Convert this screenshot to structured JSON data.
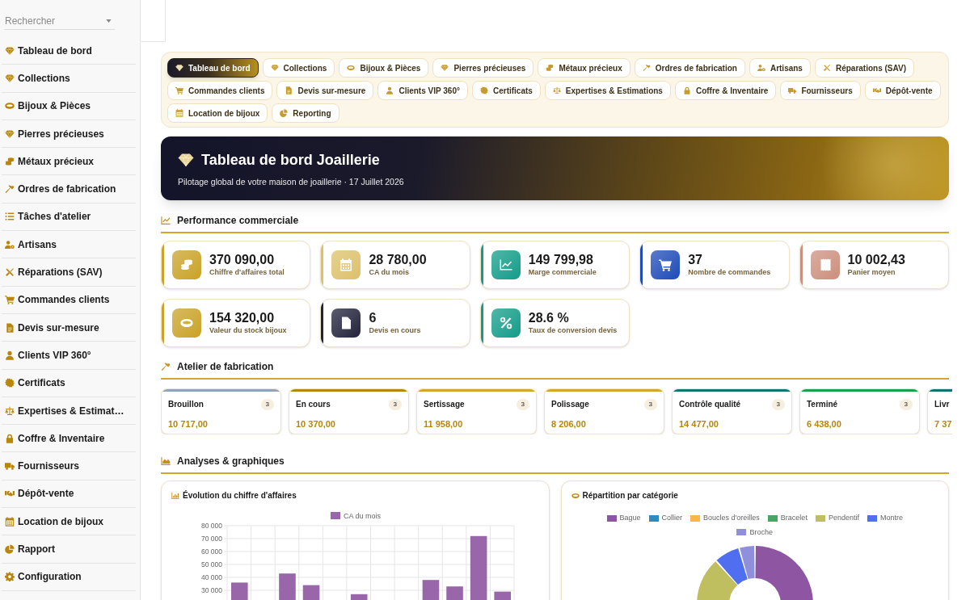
{
  "sidebar": {
    "search": {
      "placeholder": "Rechercher"
    },
    "items": [
      {
        "label": "Tableau de bord"
      },
      {
        "label": "Collections"
      },
      {
        "label": "Bijoux & Pièces"
      },
      {
        "label": "Pierres précieuses"
      },
      {
        "label": "Métaux précieux"
      },
      {
        "label": "Ordres de fabrication"
      },
      {
        "label": "Tâches d'atelier"
      },
      {
        "label": "Artisans"
      },
      {
        "label": "Réparations (SAV)"
      },
      {
        "label": "Commandes clients"
      },
      {
        "label": "Devis sur-mesure"
      },
      {
        "label": "Clients VIP 360°"
      },
      {
        "label": "Certificats"
      },
      {
        "label": "Expertises & Estimat…"
      },
      {
        "label": "Coffre & Inventaire"
      },
      {
        "label": "Fournisseurs"
      },
      {
        "label": "Dépôt-vente"
      },
      {
        "label": "Location de bijoux"
      },
      {
        "label": "Rapport"
      },
      {
        "label": "Configuration"
      }
    ]
  },
  "tabs": [
    {
      "label": "Tableau de bord",
      "selected": true
    },
    {
      "label": "Collections",
      "selected": false
    },
    {
      "label": "Bijoux & Pièces",
      "selected": false
    },
    {
      "label": "Pierres précieuses",
      "selected": false
    },
    {
      "label": "Métaux précieux",
      "selected": false
    },
    {
      "label": "Ordres de fabrication",
      "selected": false
    },
    {
      "label": "Artisans",
      "selected": false
    },
    {
      "label": "Réparations (SAV)",
      "selected": false
    },
    {
      "label": "Commandes clients",
      "selected": false
    },
    {
      "label": "Devis sur-mesure",
      "selected": false
    },
    {
      "label": "Clients VIP 360°",
      "selected": false
    },
    {
      "label": "Certificats",
      "selected": false
    },
    {
      "label": "Expertises & Estimations",
      "selected": false
    },
    {
      "label": "Coffre & Inventaire",
      "selected": false
    },
    {
      "label": "Fournisseurs",
      "selected": false
    },
    {
      "label": "Dépôt-vente",
      "selected": false
    },
    {
      "label": "Location de bijoux",
      "selected": false
    },
    {
      "label": "Reporting",
      "selected": false
    }
  ],
  "hero": {
    "title": "Tableau de bord Joaillerie",
    "subtitle": "Pilotage global de votre maison de joaillerie · 17 Juillet 2026"
  },
  "performance": {
    "title": "Performance commerciale",
    "stats": [
      {
        "value": "370 090,00",
        "label": "Chiffre d'affaires total",
        "color": "#c9a227"
      },
      {
        "value": "28 780,00",
        "label": "CA du mois",
        "color": "#dcc06a"
      },
      {
        "value": "149 799,98",
        "label": "Marge commerciale",
        "color": "#129c88"
      },
      {
        "value": "37",
        "label": "Nombre de commandes",
        "color": "#1e4bb8"
      },
      {
        "value": "10 002,43",
        "label": "Panier moyen",
        "color": "#cc8f7d"
      },
      {
        "value": "154 320,00",
        "label": "Valeur du stock bijoux",
        "color": "#c9a227"
      },
      {
        "value": "6",
        "label": "Devis en cours",
        "color": "#22223b"
      },
      {
        "value": "28.6 %",
        "label": "Taux de conversion devis",
        "color": "#129c88"
      }
    ]
  },
  "workshop": {
    "title": "Atelier de fabrication",
    "stages": [
      {
        "name": "Brouillon",
        "count": "3",
        "amount": "10 717,00",
        "color": "#94a3b8"
      },
      {
        "name": "En cours",
        "count": "3",
        "amount": "10 370,00",
        "color": "#b8860b"
      },
      {
        "name": "Sertissage",
        "count": "3",
        "amount": "11 958,00",
        "color": "#d4a72c"
      },
      {
        "name": "Polissage",
        "count": "3",
        "amount": "8 206,00",
        "color": "#d4a72c"
      },
      {
        "name": "Contrôle qualité",
        "count": "3",
        "amount": "14 477,00",
        "color": "#0f766e"
      },
      {
        "name": "Terminé",
        "count": "3",
        "amount": "6 438,00",
        "color": "#16a34a"
      },
      {
        "name": "Livr",
        "amount": "7 37",
        "color": "#0f766e"
      }
    ]
  },
  "analytics": {
    "title": "Analyses & graphiques",
    "revenue": {
      "title": "Évolution du chiffre d'affaires",
      "chart_data": {
        "type": "bar",
        "ylim": [
          0,
          80000
        ],
        "grid": true,
        "series": [
          {
            "name": "CA du mois",
            "color": "#9966aa",
            "values": [
              36000,
              null,
              43000,
              34000,
              null,
              27000,
              null,
              null,
              38000,
              33000,
              72000,
              29000
            ]
          }
        ],
        "yticks": [
          {
            "value": 30000,
            "label": "30 000"
          },
          {
            "value": 40000,
            "label": "40 000"
          },
          {
            "value": 50000,
            "label": "50 000"
          },
          {
            "value": 60000,
            "label": "60 000"
          },
          {
            "value": 70000,
            "label": "70 000"
          },
          {
            "value": 80000,
            "label": "80 000"
          }
        ]
      }
    },
    "categories": {
      "title": "Répartition par catégorie",
      "legend": [
        {
          "label": "Bague",
          "color": "#8e55a3"
        },
        {
          "label": "Collier",
          "color": "#2e8bc0"
        },
        {
          "label": "Boucles d'oreilles",
          "color": "#f6b84b"
        },
        {
          "label": "Bracelet",
          "color": "#4aa564"
        },
        {
          "label": "Pendentif",
          "color": "#bfbf5f"
        },
        {
          "label": "Montre",
          "color": "#4f6ef0"
        },
        {
          "label": "Broche",
          "color": "#8f8fdc"
        }
      ]
    }
  }
}
